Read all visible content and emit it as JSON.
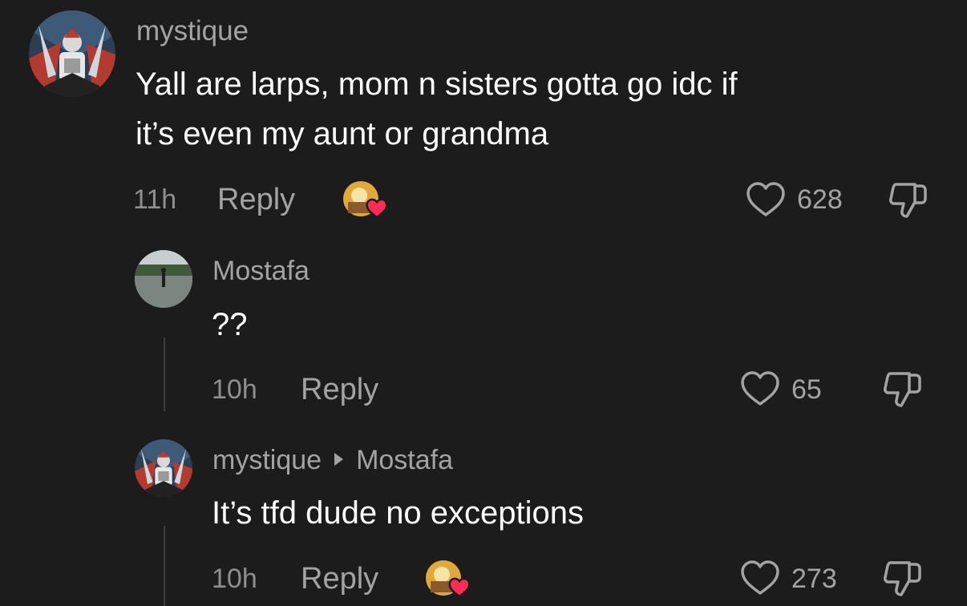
{
  "comments": [
    {
      "username": "mystique",
      "text_lines": [
        "Yall are larps, mom n sisters gotta go idc if",
        "it’s even my aunt or grandma"
      ],
      "time": "11h",
      "reply_label": "Reply",
      "likes": "628",
      "creator_liked": true
    },
    {
      "username": "Mostafa",
      "text_lines": [
        "??"
      ],
      "time": "10h",
      "reply_label": "Reply",
      "likes": "65",
      "creator_liked": false
    },
    {
      "username": "mystique",
      "reply_to": "Mostafa",
      "text_lines": [
        "It’s tfd dude no exceptions"
      ],
      "time": "10h",
      "reply_label": "Reply",
      "likes": "273",
      "creator_liked": true
    }
  ],
  "icons": {
    "like": "heart-outline-icon",
    "dislike": "thumbs-down-icon",
    "creator_liked_badge": "creator-liked-avatar-heart-icon",
    "reply_target": "caret-right-icon"
  },
  "colors": {
    "background": "#1c1c1c",
    "primary_text": "#ffffff",
    "secondary_text": "#a3a3a3",
    "heart_badge": "#fe2c55"
  }
}
